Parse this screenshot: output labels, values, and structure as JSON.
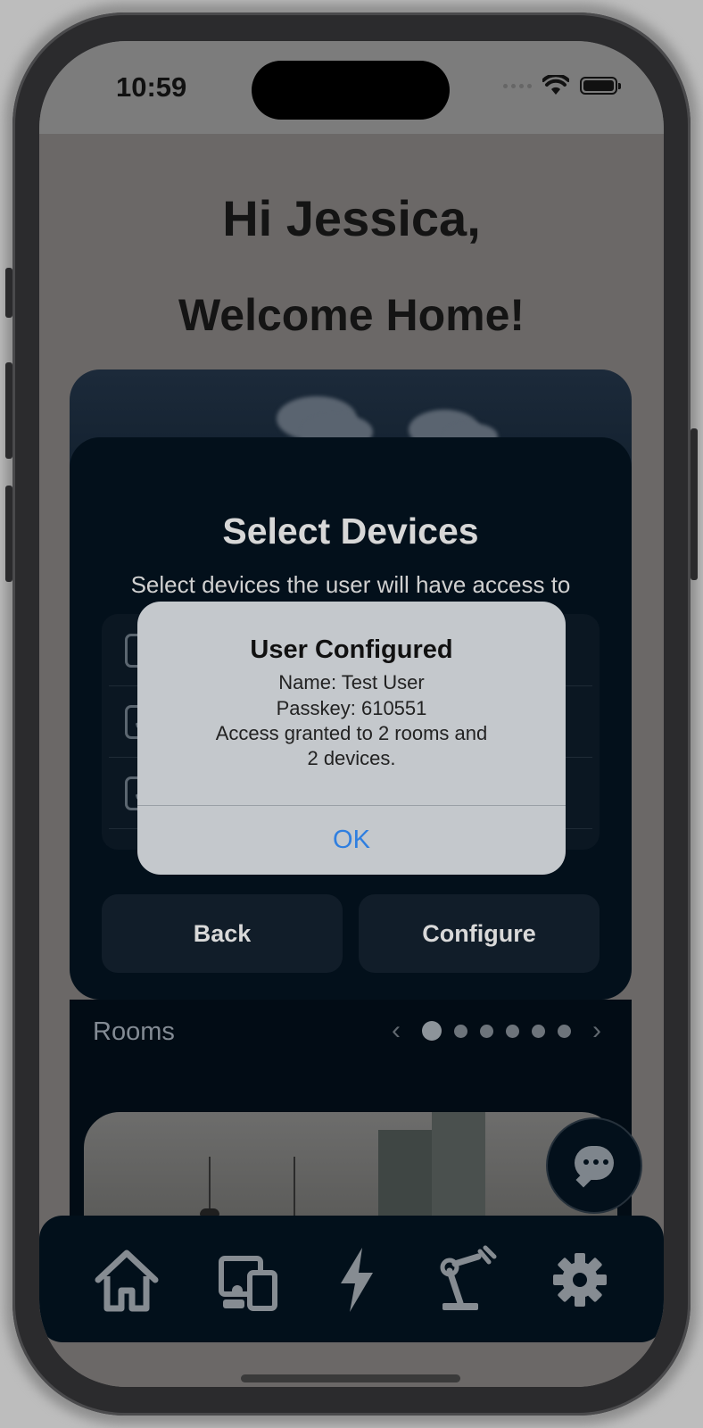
{
  "status_bar": {
    "time": "10:59",
    "icons": [
      "signal-dots-icon",
      "wifi-icon",
      "battery-icon"
    ]
  },
  "greeting": {
    "line1": "Hi Jessica,",
    "line2": "Welcome Home!"
  },
  "select_devices_modal": {
    "title": "Select Devices",
    "subtitle": "Select devices the user will have access to",
    "devices": [
      {
        "checked": false
      },
      {
        "checked": true
      },
      {
        "checked": true
      }
    ],
    "back_label": "Back",
    "configure_label": "Configure"
  },
  "rooms": {
    "title": "Rooms",
    "page_count": 6,
    "active_page": 1
  },
  "tabbar": {
    "tabs": [
      "home-icon",
      "devices-icon",
      "energy-icon",
      "robot-arm-icon",
      "settings-icon"
    ]
  },
  "alert": {
    "title": "User Configured",
    "name_line": "Name: Test User",
    "passkey_line": "Passkey: 610551",
    "access_line1": "Access granted to 2 rooms and",
    "access_line2": "2 devices.",
    "ok_label": "OK",
    "ok_color": "#2f7fe0"
  }
}
